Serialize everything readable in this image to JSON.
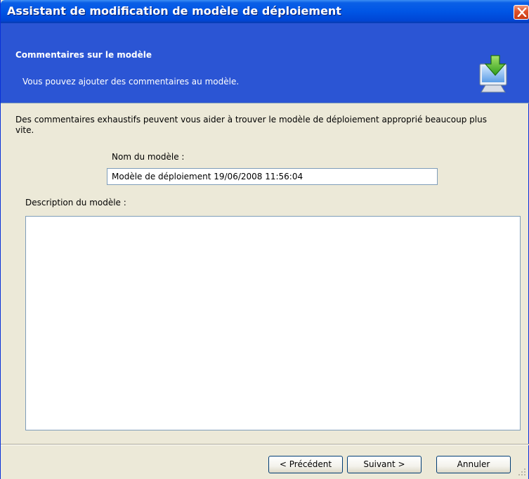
{
  "window": {
    "title": "Assistant de modification de modèle de déploiement",
    "close_icon": "close-icon"
  },
  "header": {
    "title": "Commentaires sur le modèle",
    "subtitle": "Vous pouvez ajouter des commentaires au modèle.",
    "icon": "monitor-download-icon"
  },
  "body": {
    "intro": "Des commentaires exhaustifs peuvent vous aider à trouver le modèle de déploiement approprié beaucoup plus vite.",
    "name_label": "Nom du modèle :",
    "name_value": "Modèle de déploiement 19/06/2008 11:56:04",
    "description_label": "Description du modèle :",
    "description_value": ""
  },
  "footer": {
    "prev_label": "< Précédent",
    "next_label": "Suivant >",
    "cancel_label": "Annuler"
  },
  "colors": {
    "titlebar": "#0055e5",
    "header_band": "#2b55d4",
    "dialog_bg": "#ece9d8",
    "close_button": "#e0532c"
  }
}
